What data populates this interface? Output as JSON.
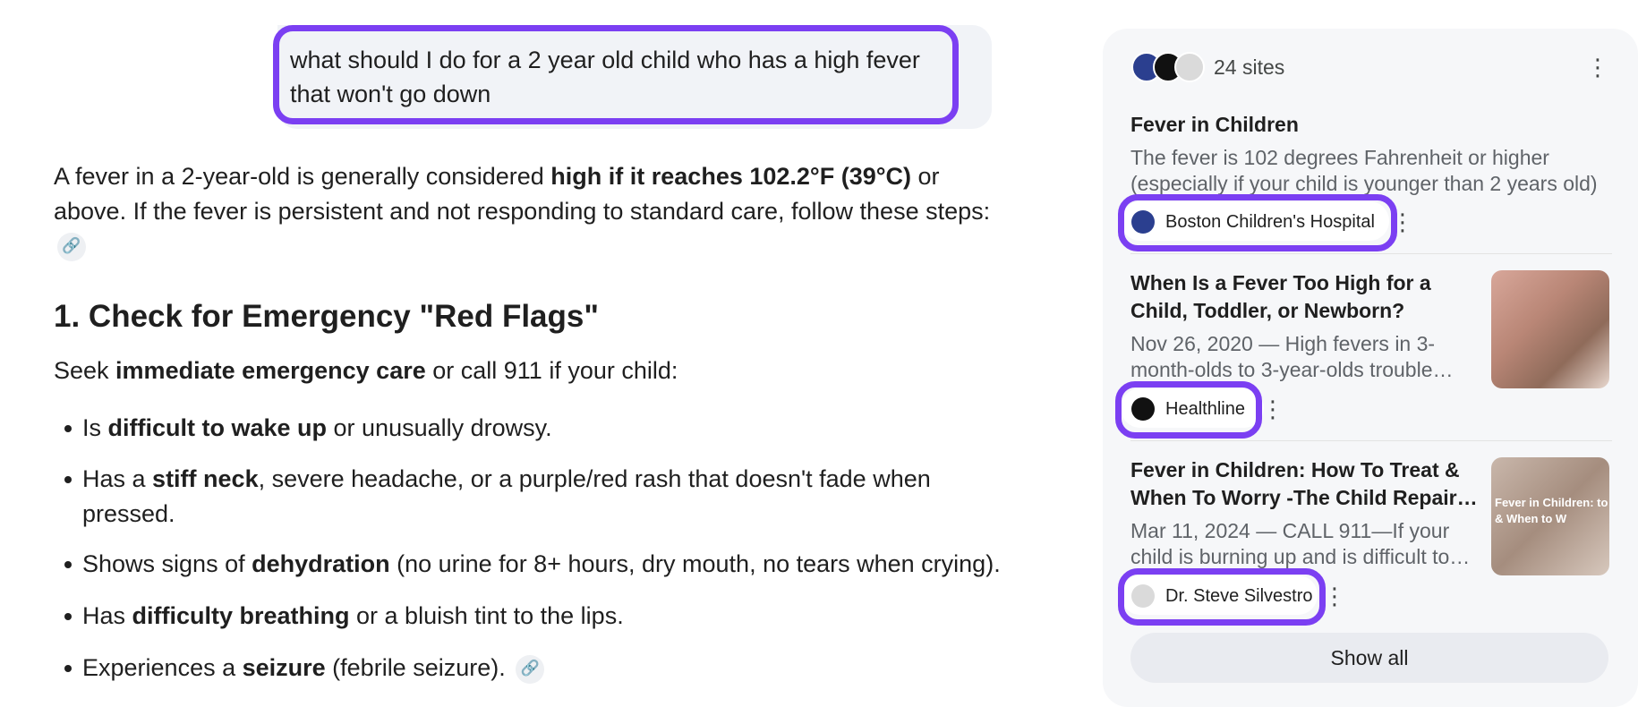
{
  "user_query": "what should I do for a 2 year old child who has a high fever that won't go down",
  "answer": {
    "intro_part1": "A fever in a 2-year-old is generally considered ",
    "intro_bold": "high if it reaches 102.2°F (39°C)",
    "intro_part2": " or above. If the fever is persistent and not responding to standard care, follow these steps:",
    "heading": "1. Check for Emergency \"Red Flags\"",
    "seek_part1": "Seek ",
    "seek_bold": "immediate emergency care",
    "seek_part2": " or call 911 if your child:",
    "bullets": [
      {
        "pre": "Is ",
        "bold": "difficult to wake up",
        "post": " or unusually drowsy."
      },
      {
        "pre": "Has a ",
        "bold": "stiff neck",
        "post": ", severe headache, or a purple/red rash that doesn't fade when pressed."
      },
      {
        "pre": "Shows signs of ",
        "bold": "dehydration",
        "post": " (no urine for 8+ hours, dry mouth, no tears when crying)."
      },
      {
        "pre": "Has ",
        "bold": "difficulty breathing",
        "post": " or a bluish tint to the lips."
      },
      {
        "pre": "Experiences a ",
        "bold": "seizure",
        "post": " (febrile seizure)."
      }
    ],
    "link_icon": "link-icon"
  },
  "sources": {
    "count_label": "24 sites",
    "show_all_label": "Show all",
    "items": [
      {
        "title": "Fever in Children",
        "snippet": "The fever is 102 degrees Fahrenheit or higher (especially if your child is younger than 2 years old)",
        "site": "Boston Children's Hospital",
        "icon": "hospital-logo-icon"
      },
      {
        "title": "When Is a Fever Too High for a Child, Toddler, or Newborn?",
        "snippet": "Nov 26, 2020 — High fevers in 3-month-olds to 3-year-olds trouble…",
        "site": "Healthline",
        "icon": "healthline-logo-icon"
      },
      {
        "title": "Fever in Children: How To Treat & When To Worry -The Child Repair…",
        "snippet": "Mar 11, 2024 — CALL 911—If your child is burning up and is difficult to…",
        "site": "Dr. Steve Silvestro",
        "icon": "stethoscope-icon",
        "thumb_text": "Fever in Children: to Do & When to W"
      }
    ]
  },
  "colors": {
    "highlight": "#7b3ff2",
    "panel_bg": "#f6f7f9",
    "user_bubble": "#f1f3f7"
  }
}
